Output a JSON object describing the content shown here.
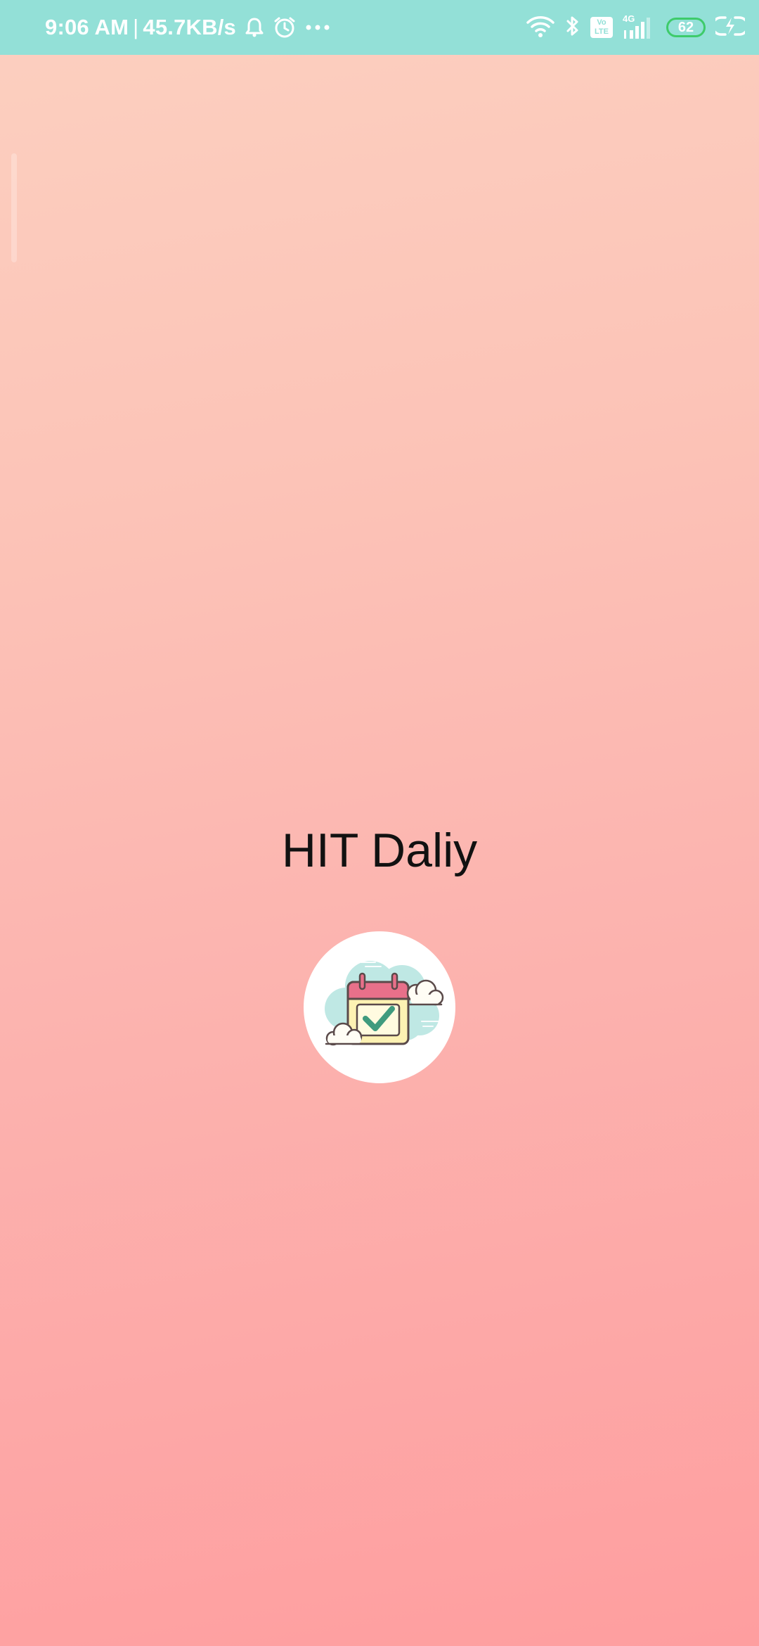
{
  "status_bar": {
    "time": "9:06 AM",
    "separator": "|",
    "net_speed": "45.7KB/s",
    "volte_top": "Vo",
    "volte_bottom": "LTE",
    "network": "4G",
    "battery": "62",
    "icons": [
      "notification-bell-icon",
      "alarm-clock-icon",
      "more-dots-icon",
      "wifi-icon",
      "bluetooth-icon",
      "volte-icon",
      "signal-icon",
      "battery-icon",
      "charging-icon"
    ]
  },
  "splash": {
    "app_title": "HIT Daliy",
    "logo_icon": "calendar-check-icon"
  },
  "colors": {
    "status_bar_bg": "#93e0d7",
    "gradient_top": "#fcd0c0",
    "gradient_bottom": "#fe9e9f",
    "battery_outline": "#3ecb6b",
    "calendar_header": "#e8708a",
    "calendar_body": "#fdf2b3",
    "check": "#3f9b7e",
    "cloud": "#bfe8e4"
  }
}
